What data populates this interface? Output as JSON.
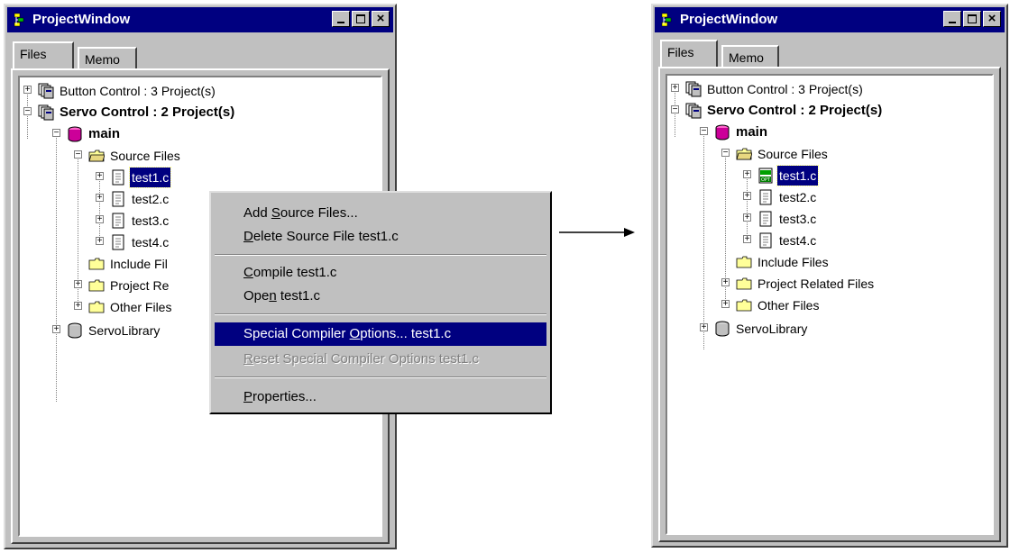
{
  "left_window": {
    "title": "ProjectWindow",
    "tabs": [
      {
        "label": "Files"
      },
      {
        "label": "Memo"
      }
    ],
    "tree": {
      "button_control": "Button Control : 3 Project(s)",
      "servo_control": "Servo Control : 2 Project(s)",
      "main": "main",
      "source_files": "Source Files",
      "files": [
        "test1.c",
        "test2.c",
        "test3.c",
        "test4.c"
      ],
      "include_files": "Include Fil",
      "project_related": "Project Re",
      "other_files": "Other Files",
      "servo_library": "ServoLibrary"
    }
  },
  "context_menu": {
    "items": [
      {
        "pre": "Add ",
        "key": "S",
        "post": "ource Files..."
      },
      {
        "pre": "",
        "key": "D",
        "post": "elete Source File  test1.c"
      },
      {
        "pre": "",
        "key": "C",
        "post": "ompile  test1.c"
      },
      {
        "pre": "Ope",
        "key": "n",
        "post": "  test1.c"
      },
      {
        "pre": "Special Compiler ",
        "key": "O",
        "post": "ptions...   test1.c"
      },
      {
        "pre": "",
        "key": "R",
        "post": "eset Special Compiler Options  test1.c"
      },
      {
        "pre": "",
        "key": "P",
        "post": "roperties..."
      }
    ],
    "highlighted_index": 4,
    "disabled_index": 5
  },
  "right_window": {
    "title": "ProjectWindow",
    "tabs": [
      {
        "label": "Files"
      },
      {
        "label": "Memo"
      }
    ],
    "tree": {
      "button_control": "Button Control : 3 Project(s)",
      "servo_control": "Servo Control : 2 Project(s)",
      "main": "main",
      "source_files": "Source Files",
      "files": [
        "test1.c",
        "test2.c",
        "test3.c",
        "test4.c"
      ],
      "include_files": "Include Files",
      "project_related": "Project Related Files",
      "other_files": "Other Files",
      "servo_library": "ServoLibrary"
    }
  },
  "colors": {
    "selection": "#000080",
    "window_face": "#c0c0c0",
    "titlebar": "#000080"
  },
  "icons": [
    "project-window-icon",
    "project-group-icon",
    "database-icon",
    "folder-icon",
    "file-icon",
    "special-options-file-icon"
  ]
}
